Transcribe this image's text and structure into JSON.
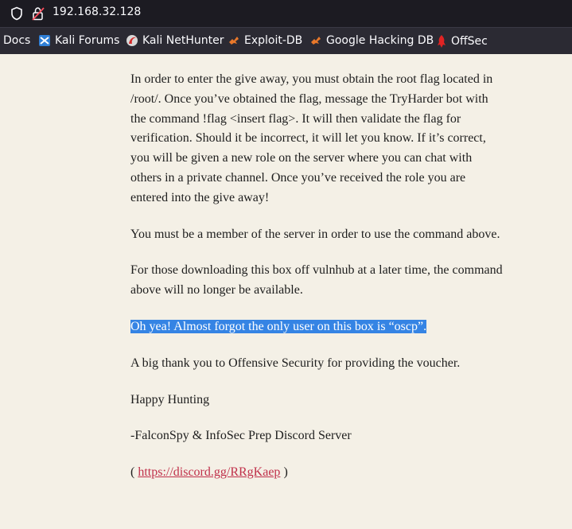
{
  "browser": {
    "url": "192.168.32.128",
    "bookmarks": [
      {
        "label": "Docs",
        "icon": "none"
      },
      {
        "label": "Kali Forums",
        "icon": "kali-forums-icon"
      },
      {
        "label": "Kali NetHunter",
        "icon": "kali-nethunter-icon"
      },
      {
        "label": "Exploit-DB",
        "icon": "exploit-db-icon"
      },
      {
        "label": "Google Hacking DB",
        "icon": "ghdb-icon"
      },
      {
        "label": "OffSec",
        "icon": "offsec-icon"
      }
    ]
  },
  "page": {
    "p1": "In order to enter the give away, you must obtain the root flag located in /root/. Once you’ve obtained the flag, message the TryHarder bot with the command !flag <insert flag>. It will then validate the flag for verification. Should it be incorrect, it will let you know. If it’s correct, you will be given a new role on the server where you can chat with others in a private channel. Once you’ve received the role you are entered into the give away!",
    "p2": "You must be a member of the server in order to use the command above.",
    "p3": "For those downloading this box off vulnhub at a later time, the command above will no longer be available.",
    "p4_highlighted": "Oh yea! Almost forgot the only user on this box is “oscp”.",
    "p5": "A big thank you to Offensive Security for providing the voucher.",
    "p6": "Happy Hunting",
    "p7": "-FalconSpy & InfoSec Prep Discord Server",
    "link_open": "( ",
    "link_text": "https://discord.gg/RRgKaep",
    "link_close": " )"
  },
  "colors": {
    "page_background": "#f4f0e6",
    "selection": "#3584e4",
    "link": "#c0304a",
    "toolbar": "#1c1b22",
    "bookmarks_bar": "#2b2a33"
  }
}
